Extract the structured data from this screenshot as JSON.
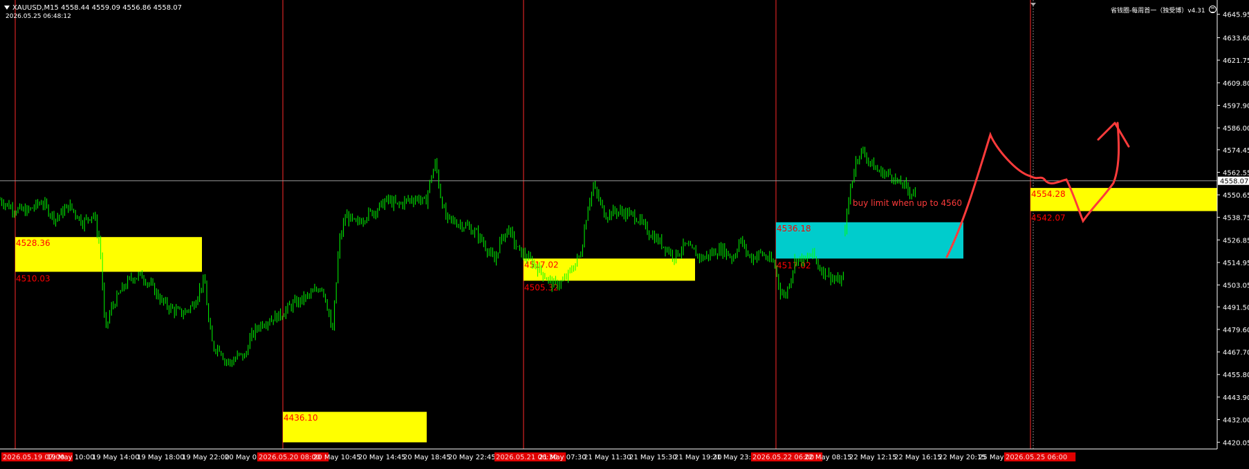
{
  "header": {
    "symbol_line": "XAUUSD,M15  4558.44 4559.09 4556.86 4558.07",
    "timestamp": "2026.05.25 06:48:12",
    "indicator_label": "省钱圈-每周首一（独受博）v4.31"
  },
  "colors": {
    "background": "#000000",
    "axis": "#ffffff",
    "candle": "#00ff00",
    "zone_yellow": "#ffff00",
    "zone_cyan": "#00cccc",
    "zone_label": "#ff0000",
    "separator": "#ff2a2a",
    "annotation": "#ff3b3b",
    "time_badge": "#e00000"
  },
  "chart_data": {
    "type": "candlestick",
    "symbol": "XAUUSD",
    "timeframe": "M15",
    "ohlc": {
      "open": 4558.44,
      "high": 4559.09,
      "low": 4556.86,
      "close": 4558.07
    },
    "current_price": "4558.07",
    "ylim": [
      4420,
      4652
    ],
    "y_ticks": [
      "4645.95",
      "4633.60",
      "4621.75",
      "4609.80",
      "4597.90",
      "4586.00",
      "4574.45",
      "4562.55",
      "4550.65",
      "4538.75",
      "4526.85",
      "4514.95",
      "4503.05",
      "4491.50",
      "4479.60",
      "4467.70",
      "4455.80",
      "4443.90",
      "4432.00",
      "4420.05"
    ],
    "x_labels": [
      {
        "text": "2026.05.19 07:00",
        "badge": true
      },
      {
        "text": "19 May 10:00",
        "badge": false
      },
      {
        "text": "19 May 14:00",
        "badge": false
      },
      {
        "text": "19 May 18:00",
        "badge": false
      },
      {
        "text": "19 May 22:00",
        "badge": false
      },
      {
        "text": "20 May 02",
        "badge": false
      },
      {
        "text": "2026.05.20 08:00",
        "badge": true
      },
      {
        "text": "20 May 10:45",
        "badge": false
      },
      {
        "text": "20 May 14:45",
        "badge": false
      },
      {
        "text": "20 May 18:45",
        "badge": false
      },
      {
        "text": "20 May 22:45",
        "badge": false
      },
      {
        "text": "2026.05.21 06:30",
        "badge": true
      },
      {
        "text": "21 May 07:30",
        "badge": false
      },
      {
        "text": "21 May 11:30",
        "badge": false
      },
      {
        "text": "21 May 15:30",
        "badge": false
      },
      {
        "text": "21 May 19:30",
        "badge": false
      },
      {
        "text": "21 May 23:3",
        "badge": false
      },
      {
        "text": "2026.05.22 06:00",
        "badge": true
      },
      {
        "text": "22 May 08:15",
        "badge": false
      },
      {
        "text": "22 May 12:15",
        "badge": false
      },
      {
        "text": "22 May 16:15",
        "badge": false
      },
      {
        "text": "22 May 20:15",
        "badge": false
      },
      {
        "text": "25 May",
        "badge": false
      },
      {
        "text": "2026.05.25 06:00",
        "badge": true
      }
    ],
    "session_separators": [
      "2026.05.19 07:00",
      "2026.05.20 08:00",
      "2026.05.21 06:30",
      "2026.05.22 06:00",
      "2026.05.25 06:00"
    ],
    "zones": [
      {
        "color": "yellow",
        "top": 4528.36,
        "bottom": 4510.03,
        "top_label": "4528.36",
        "bottom_label": "4510.03"
      },
      {
        "color": "yellow",
        "top": 4436.1,
        "bottom": 4420.0,
        "top_label": "4436.10",
        "bottom_label": ""
      },
      {
        "color": "yellow",
        "top": 4517.02,
        "bottom": 4505.32,
        "top_label": "4517.02",
        "bottom_label": "4505.32"
      },
      {
        "color": "cyan",
        "top": 4536.18,
        "bottom": 4517.02,
        "top_label": "4536.18",
        "bottom_label": "4517.02"
      },
      {
        "color": "yellow",
        "top": 4554.28,
        "bottom": 4542.07,
        "top_label": "4554.28",
        "bottom_label": "4542.07"
      }
    ],
    "price_path_anchors": [
      [
        0,
        4548
      ],
      [
        20,
        4543
      ],
      [
        40,
        4542
      ],
      [
        60,
        4547
      ],
      [
        80,
        4538
      ],
      [
        100,
        4545
      ],
      [
        120,
        4536
      ],
      [
        135,
        4541
      ],
      [
        145,
        4523
      ],
      [
        152,
        4478
      ],
      [
        160,
        4490
      ],
      [
        175,
        4500
      ],
      [
        190,
        4507
      ],
      [
        205,
        4508
      ],
      [
        220,
        4502
      ],
      [
        235,
        4494
      ],
      [
        250,
        4490
      ],
      [
        265,
        4488
      ],
      [
        280,
        4493
      ],
      [
        290,
        4502
      ],
      [
        296,
        4505
      ],
      [
        302,
        4482
      ],
      [
        308,
        4470
      ],
      [
        318,
        4470
      ],
      [
        325,
        4463
      ],
      [
        335,
        4462
      ],
      [
        345,
        4466
      ],
      [
        355,
        4465
      ],
      [
        360,
        4474
      ],
      [
        375,
        4482
      ],
      [
        390,
        4485
      ],
      [
        405,
        4487
      ],
      [
        420,
        4492
      ],
      [
        435,
        4495
      ],
      [
        450,
        4498
      ],
      [
        465,
        4503
      ],
      [
        475,
        4490
      ],
      [
        480,
        4475
      ],
      [
        485,
        4498
      ],
      [
        490,
        4525
      ],
      [
        500,
        4540
      ],
      [
        515,
        4535
      ],
      [
        530,
        4540
      ],
      [
        545,
        4543
      ],
      [
        560,
        4548
      ],
      [
        575,
        4545
      ],
      [
        590,
        4548
      ],
      [
        605,
        4549
      ],
      [
        615,
        4546
      ],
      [
        622,
        4558
      ],
      [
        630,
        4568
      ],
      [
        636,
        4552
      ],
      [
        645,
        4538
      ],
      [
        660,
        4536
      ],
      [
        675,
        4534
      ],
      [
        690,
        4530
      ],
      [
        705,
        4522
      ],
      [
        715,
        4515
      ],
      [
        722,
        4525
      ],
      [
        735,
        4533
      ],
      [
        748,
        4522
      ],
      [
        760,
        4518
      ],
      [
        775,
        4513
      ],
      [
        790,
        4507
      ],
      [
        800,
        4503
      ],
      [
        815,
        4505
      ],
      [
        828,
        4512
      ],
      [
        840,
        4520
      ],
      [
        850,
        4545
      ],
      [
        858,
        4555
      ],
      [
        866,
        4548
      ],
      [
        875,
        4540
      ],
      [
        890,
        4542
      ],
      [
        905,
        4541
      ],
      [
        920,
        4539
      ],
      [
        935,
        4532
      ],
      [
        950,
        4527
      ],
      [
        965,
        4522
      ],
      [
        975,
        4518
      ],
      [
        990,
        4524
      ],
      [
        1005,
        4520
      ],
      [
        1015,
        4517
      ],
      [
        1030,
        4520
      ],
      [
        1045,
        4522
      ],
      [
        1060,
        4517
      ],
      [
        1070,
        4527
      ],
      [
        1085,
        4517
      ],
      [
        1100,
        4520
      ],
      [
        1110,
        4517
      ],
      [
        1120,
        4514
      ],
      [
        1128,
        4500
      ],
      [
        1135,
        4497
      ],
      [
        1142,
        4505
      ],
      [
        1150,
        4517
      ],
      [
        1165,
        4516
      ],
      [
        1175,
        4520
      ],
      [
        1185,
        4512
      ],
      [
        1200,
        4508
      ],
      [
        1210,
        4505
      ],
      [
        1220,
        4506
      ]
    ],
    "price_path_anchors_2": [
      [
        1222,
        4533
      ],
      [
        1230,
        4555
      ],
      [
        1238,
        4569
      ],
      [
        1245,
        4574
      ],
      [
        1252,
        4571
      ],
      [
        1260,
        4567
      ],
      [
        1270,
        4563
      ],
      [
        1280,
        4562
      ],
      [
        1290,
        4561
      ],
      [
        1300,
        4556
      ],
      [
        1305,
        4557
      ],
      [
        1312,
        4553
      ],
      [
        1318,
        4552
      ],
      [
        1324,
        4553
      ]
    ],
    "annotation": {
      "text": "buy limit when up to 4560"
    }
  }
}
